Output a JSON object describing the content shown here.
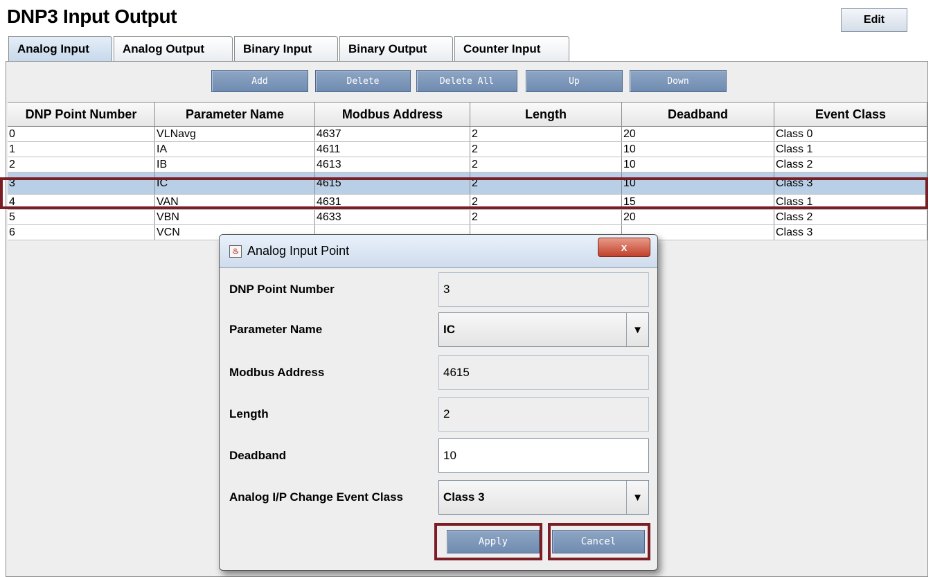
{
  "page": {
    "title": "DNP3 Input Output",
    "edit_label": "Edit"
  },
  "tabs": [
    {
      "label": "Analog Input",
      "active": true
    },
    {
      "label": "Analog Output",
      "active": false
    },
    {
      "label": "Binary Input",
      "active": false
    },
    {
      "label": "Binary Output",
      "active": false
    },
    {
      "label": "Counter Input",
      "active": false
    }
  ],
  "toolbar": {
    "add": "Add",
    "delete": "Delete",
    "delete_all": "Delete All",
    "up": "Up",
    "down": "Down"
  },
  "table": {
    "columns": [
      "DNP Point Number",
      "Parameter Name",
      "Modbus Address",
      "Length",
      "Deadband",
      "Event Class"
    ],
    "rows": [
      [
        "0",
        "VLNavg",
        "4637",
        "2",
        "20",
        "Class 0"
      ],
      [
        "1",
        "IA",
        "4611",
        "2",
        "10",
        "Class 1"
      ],
      [
        "2",
        "IB",
        "4613",
        "2",
        "10",
        "Class 2"
      ],
      [
        "3",
        "IC",
        "4615",
        "2",
        "10",
        "Class 3"
      ],
      [
        "4",
        "VAN",
        "4631",
        "2",
        "15",
        "Class 1"
      ],
      [
        "5",
        "VBN",
        "4633",
        "2",
        "20",
        "Class 2"
      ],
      [
        "6",
        "VCN",
        "",
        "",
        "",
        "Class 3"
      ]
    ],
    "selected_row": 3
  },
  "dialog": {
    "title": "Analog Input Point",
    "close": "x",
    "fields": [
      {
        "label": "DNP Point Number",
        "value": "3"
      },
      {
        "label": "Parameter Name",
        "value": "IC"
      },
      {
        "label": "Modbus Address",
        "value": "4615"
      },
      {
        "label": "Length",
        "value": "2"
      },
      {
        "label": "Deadband",
        "value": "10"
      },
      {
        "label": "Analog I/P Change Event Class",
        "value": "Class 3"
      }
    ],
    "apply": "Apply",
    "cancel": "Cancel"
  },
  "colors": {
    "highlight": "#7b1d24",
    "selected_row": "#b8cfe5",
    "button_blue": "#7f98ba"
  }
}
